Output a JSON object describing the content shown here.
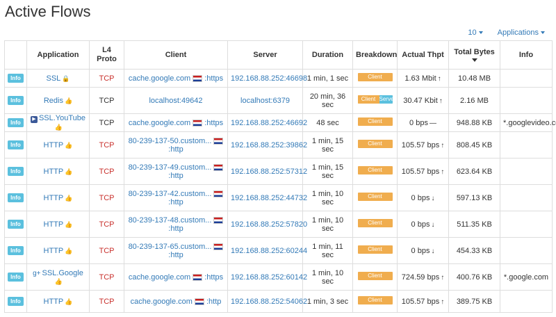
{
  "page": {
    "title": "Active Flows"
  },
  "controls": {
    "rows_per_page": "10",
    "applications_filter": "Applications"
  },
  "table": {
    "headers": {
      "application": "Application",
      "l4_proto": "L4 Proto",
      "client": "Client",
      "server": "Server",
      "duration": "Duration",
      "breakdown": "Breakdown",
      "actual_thpt": "Actual Thpt",
      "total_bytes": "Total Bytes",
      "info": "Info"
    },
    "rows": [
      {
        "badge": "Info",
        "app": "SSL",
        "app_icon": "lock-icon",
        "proto": "TCP",
        "client": "cache.google.com",
        "client_suffix": ":https",
        "client_flag": true,
        "server": "192.168.88.252:46698",
        "duration": "1 min, 1 sec",
        "breakdown_client": "Client",
        "breakdown_server": "",
        "thpt": "1.63 Mbit",
        "trend": "up",
        "bytes": "10.48 MB",
        "info": ""
      },
      {
        "badge": "Info",
        "app": "Redis",
        "app_icon": "thumbs-up-icon",
        "proto": "TCP",
        "client": "localhost:49642",
        "client_suffix": "",
        "client_flag": false,
        "server": "localhost:6379",
        "duration": "20 min, 36 sec",
        "breakdown_client": "Client",
        "breakdown_server": "Serve",
        "thpt": "30.47 Kbit",
        "trend": "up",
        "bytes": "2.16 MB",
        "info": ""
      },
      {
        "badge": "Info",
        "app": "SSL.YouTube",
        "app_icon": "youtube-icon",
        "proto": "TCP",
        "client": "cache.google.com",
        "client_suffix": ":https",
        "client_flag": true,
        "server": "192.168.88.252:46692",
        "duration": "48 sec",
        "breakdown_client": "Client",
        "breakdown_server": "",
        "thpt": "0 bps",
        "trend": "flat",
        "bytes": "948.88 KB",
        "info": "*.googlevideo.com"
      },
      {
        "badge": "Info",
        "app": "HTTP",
        "app_icon": "thumbs-up-icon",
        "proto": "TCP",
        "client": "80-239-137-50.custom...",
        "client_suffix": ":http",
        "client_flag": true,
        "server": "192.168.88.252:39862",
        "duration": "1 min, 15 sec",
        "breakdown_client": "Client",
        "breakdown_server": "",
        "thpt": "105.57 bps",
        "trend": "up",
        "bytes": "808.45 KB",
        "info": ""
      },
      {
        "badge": "Info",
        "app": "HTTP",
        "app_icon": "thumbs-up-icon",
        "proto": "TCP",
        "client": "80-239-137-49.custom...",
        "client_suffix": ":http",
        "client_flag": true,
        "server": "192.168.88.252:57312",
        "duration": "1 min, 15 sec",
        "breakdown_client": "Client",
        "breakdown_server": "",
        "thpt": "105.57 bps",
        "trend": "up",
        "bytes": "623.64 KB",
        "info": ""
      },
      {
        "badge": "Info",
        "app": "HTTP",
        "app_icon": "thumbs-up-icon",
        "proto": "TCP",
        "client": "80-239-137-42.custom...",
        "client_suffix": ":http",
        "client_flag": true,
        "server": "192.168.88.252:44732",
        "duration": "1 min, 10 sec",
        "breakdown_client": "Client",
        "breakdown_server": "",
        "thpt": "0 bps",
        "trend": "down",
        "bytes": "597.13 KB",
        "info": ""
      },
      {
        "badge": "Info",
        "app": "HTTP",
        "app_icon": "thumbs-up-icon",
        "proto": "TCP",
        "client": "80-239-137-48.custom...",
        "client_suffix": ":http",
        "client_flag": true,
        "server": "192.168.88.252:57820",
        "duration": "1 min, 10 sec",
        "breakdown_client": "Client",
        "breakdown_server": "",
        "thpt": "0 bps",
        "trend": "down",
        "bytes": "511.35 KB",
        "info": ""
      },
      {
        "badge": "Info",
        "app": "HTTP",
        "app_icon": "thumbs-up-icon",
        "proto": "TCP",
        "client": "80-239-137-65.custom...",
        "client_suffix": ":http",
        "client_flag": true,
        "server": "192.168.88.252:60244",
        "duration": "1 min, 11 sec",
        "breakdown_client": "Client",
        "breakdown_server": "",
        "thpt": "0 bps",
        "trend": "down",
        "bytes": "454.33 KB",
        "info": ""
      },
      {
        "badge": "Info",
        "app": "SSL.Google",
        "app_icon": "google-plus-icon",
        "proto": "TCP",
        "client": "cache.google.com",
        "client_suffix": ":https",
        "client_flag": true,
        "server": "192.168.88.252:60142",
        "duration": "1 min, 10 sec",
        "breakdown_client": "Client",
        "breakdown_server": "",
        "thpt": "724.59 bps",
        "trend": "up",
        "bytes": "400.76 KB",
        "info": "*.google.com"
      },
      {
        "badge": "Info",
        "app": "HTTP",
        "app_icon": "thumbs-up-icon",
        "proto": "TCP",
        "client": "cache.google.com",
        "client_suffix": ":http",
        "client_flag": true,
        "server": "192.168.88.252:54062",
        "duration": "1 min, 3 sec",
        "breakdown_client": "Client",
        "breakdown_server": "",
        "thpt": "105.57 bps",
        "trend": "up",
        "bytes": "389.75 KB",
        "info": ""
      }
    ]
  },
  "colors": {
    "link": "#337ab7",
    "proto_tcp": "#c9302c",
    "client_bar": "#f0ad4e",
    "server_bar": "#5bc0de",
    "info_badge": "#5bc0de"
  }
}
